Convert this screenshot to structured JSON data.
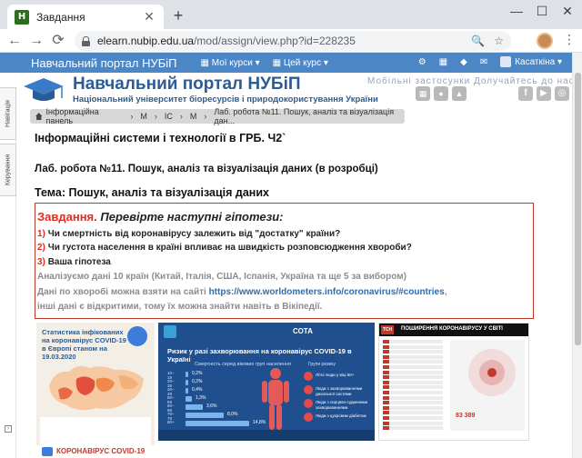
{
  "browser": {
    "tab_title": "Завдання",
    "favicon_letter": "H",
    "close": "✕",
    "new_tab": "+",
    "minimize": "—",
    "maximize": "☐",
    "close_window": "✕",
    "back": "←",
    "forward": "→",
    "reload": "⟳",
    "url_host": "elearn.nubip.edu.ua",
    "url_path": "/mod/assign/view.php?id=228235",
    "zoom_icon": "🔍",
    "star_icon": "☆",
    "menu": "⋮"
  },
  "navbar": {
    "brand": "Навчальний портал НУБіП",
    "my_courses": "Мої курси ▾",
    "this_course": "Цей курс ▾",
    "user": "Касаткіна ▾"
  },
  "header": {
    "title": "Навчальний портал НУБіП",
    "subtitle": "Національний університет біоресурсів і природокористування України",
    "apps_text": "Мобільні застосунки Долучайтесь до нас"
  },
  "sidebar": {
    "tab1": "Навігація",
    "tab2": "Керування"
  },
  "breadcrumb": {
    "items": [
      "Інформаційна панель",
      "М",
      "ІС",
      "М",
      "Лаб. робота №11. Пошук, аналіз та візуалізація дан..."
    ]
  },
  "content": {
    "course_title": "Інформаційні системи і технології в ГРБ. Ч2`",
    "lab_title": "Лаб. робота №11. Пошук, аналіз та візуалізація даних (в розробці)",
    "topic_title": "Тема: Пошук, аналіз та візуалізація даних",
    "task_label": "Завдання.",
    "task_italic": "Перевірте наступні гіпотези:",
    "hyp1_num": "1)",
    "hyp1_text": "Чи смертність від коронавірусу залежить від \"достатку\" країни?",
    "hyp2_num": "2)",
    "hyp2_text": "Чи густота населення в країні впливає на швидкість розповсюдження хвороби?",
    "hyp3_num": "3)",
    "hyp3_text": "Ваша гіпотеза",
    "analyze_text": "Аналізуємо дані 10 країн (Китай, Італія, США, Іспанія, Україна та ще 5 за вибором)",
    "data_text_before": "Дані по хворобі можна взяти на сайті",
    "data_link": "https://www.worldometers.info/coronavirus/#countries",
    "data_text_after": ",",
    "other_text": "інші дані є відкритими, тому  їх можна знайти навіть в Вікіпедії."
  },
  "infographic1": {
    "title": "Статистика інфікованих на коронавірус COVID-19 в Європі станом на 19.03.2020",
    "bottom_label": "КОРОНАВІРУС COVID-19"
  },
  "infographic2": {
    "brand": "СОТА",
    "title": "Ризик у разі захворювання на коронавірус COVID-19 в Україні",
    "subtitle": "Смертність серед вікових груп населення",
    "risk_group": "Групи ризику",
    "bars": [
      {
        "label": "10–19",
        "value": "0,2%",
        "frac": 0.015
      },
      {
        "label": "20–39",
        "value": "0,2%",
        "frac": 0.015
      },
      {
        "label": "40–49",
        "value": "0,4%",
        "frac": 0.03
      },
      {
        "label": "50–59",
        "value": "1,3%",
        "frac": 0.1
      },
      {
        "label": "60–69",
        "value": "3,6%",
        "frac": 0.27
      },
      {
        "label": "70–79",
        "value": "8,0%",
        "frac": 0.6
      },
      {
        "label": "80+",
        "value": "14,8%",
        "frac": 1.0
      }
    ],
    "risks": [
      "Літні люди у віці 60+",
      "Люди з захворюваннями дихальної системи",
      "Люди з серцево-судинними захворюваннями",
      "Люди з цукровим діабетом"
    ]
  },
  "infographic3": {
    "badge": "ТСН",
    "title": "ПОШИРЕННЯ КОРОНАВІРУСУ У СВІТІ",
    "total": "83 389"
  }
}
